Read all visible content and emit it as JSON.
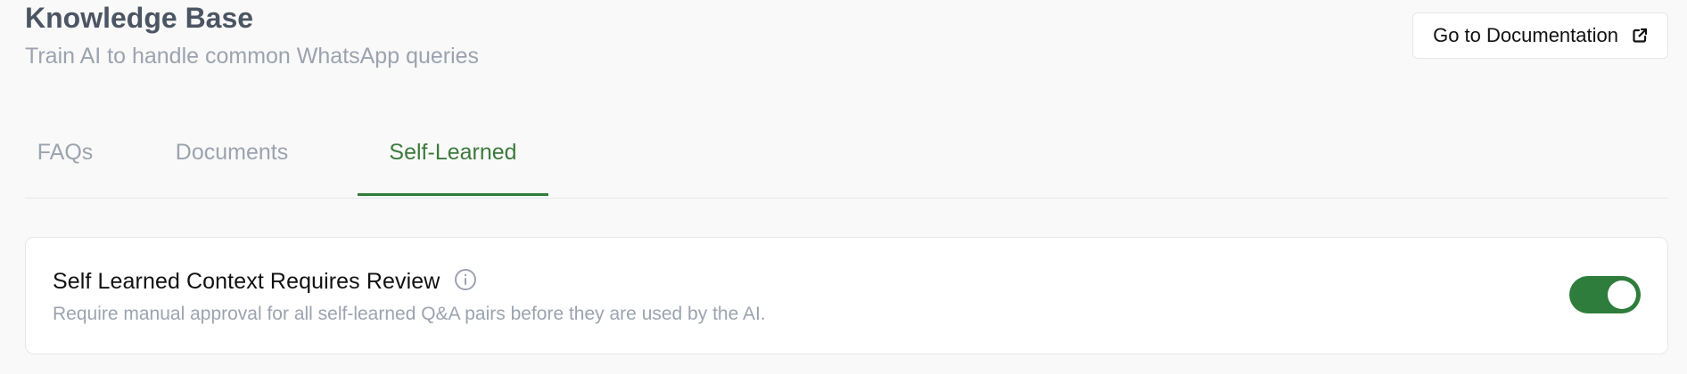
{
  "header": {
    "title": "Knowledge Base",
    "subtitle": "Train AI to handle common WhatsApp queries",
    "doc_button_label": "Go to Documentation",
    "doc_button_icon": "external-link-icon"
  },
  "tabs": [
    {
      "label": "FAQs",
      "active": false
    },
    {
      "label": "Documents",
      "active": false
    },
    {
      "label": "Self-Learned",
      "active": true
    }
  ],
  "setting": {
    "title": "Self Learned Context Requires Review",
    "info_icon": "info-icon",
    "description": "Require manual approval for all self-learned Q&A pairs before they are used by the AI.",
    "enabled": true
  },
  "colors": {
    "accent": "#2e7d3c",
    "active_tab_text": "#3d7a3d",
    "muted_text": "#9ca3af",
    "title_text": "#4b5563"
  }
}
